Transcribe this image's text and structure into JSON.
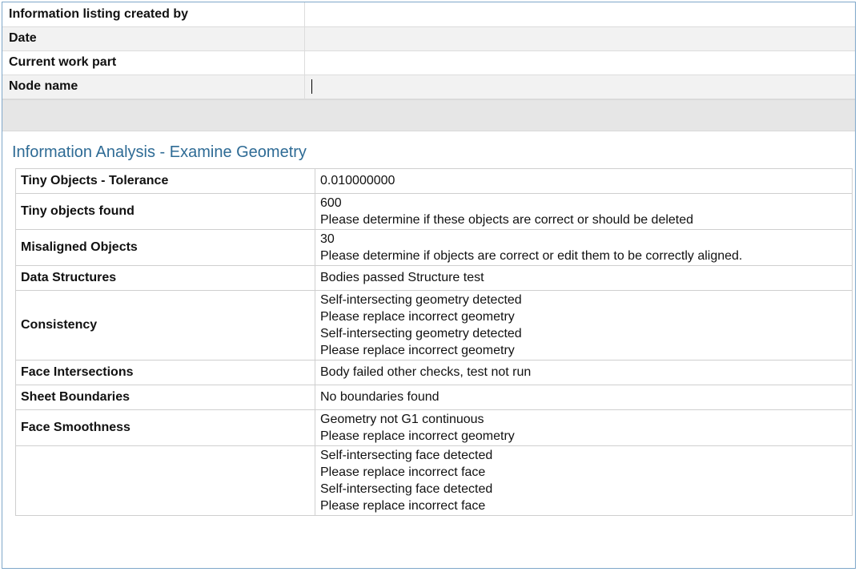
{
  "header_rows": [
    {
      "label": "Information listing created by",
      "value": ""
    },
    {
      "label": "Date",
      "value": ""
    },
    {
      "label": "Current work part",
      "value": ""
    },
    {
      "label": "Node name",
      "value": ""
    }
  ],
  "section_title": "Information Analysis - Examine Geometry",
  "analysis_rows": [
    {
      "label": "Tiny Objects - Tolerance",
      "lines": [
        "0.010000000"
      ]
    },
    {
      "label": "Tiny objects found",
      "lines": [
        "600",
        "Please determine if these objects are correct or should be deleted"
      ]
    },
    {
      "label": "Misaligned Objects",
      "lines": [
        "30",
        "Please determine if objects are correct or edit them to be correctly aligned."
      ]
    },
    {
      "label": "Data Structures",
      "lines": [
        "Bodies passed Structure test"
      ]
    },
    {
      "label": "Consistency",
      "lines": [
        "Self-intersecting geometry detected",
        "Please replace incorrect geometry",
        "Self-intersecting geometry detected",
        "Please replace incorrect geometry"
      ]
    },
    {
      "label": "Face Intersections",
      "lines": [
        "Body failed other checks, test not run"
      ]
    },
    {
      "label": "Sheet Boundaries",
      "lines": [
        "No boundaries found"
      ]
    },
    {
      "label": "Face Smoothness",
      "lines": [
        "Geometry not G1 continuous",
        "Please replace incorrect geometry"
      ]
    },
    {
      "label": "",
      "lines": [
        "Self-intersecting face detected",
        "Please replace incorrect face",
        "Self-intersecting face detected",
        "Please replace incorrect face"
      ]
    }
  ]
}
